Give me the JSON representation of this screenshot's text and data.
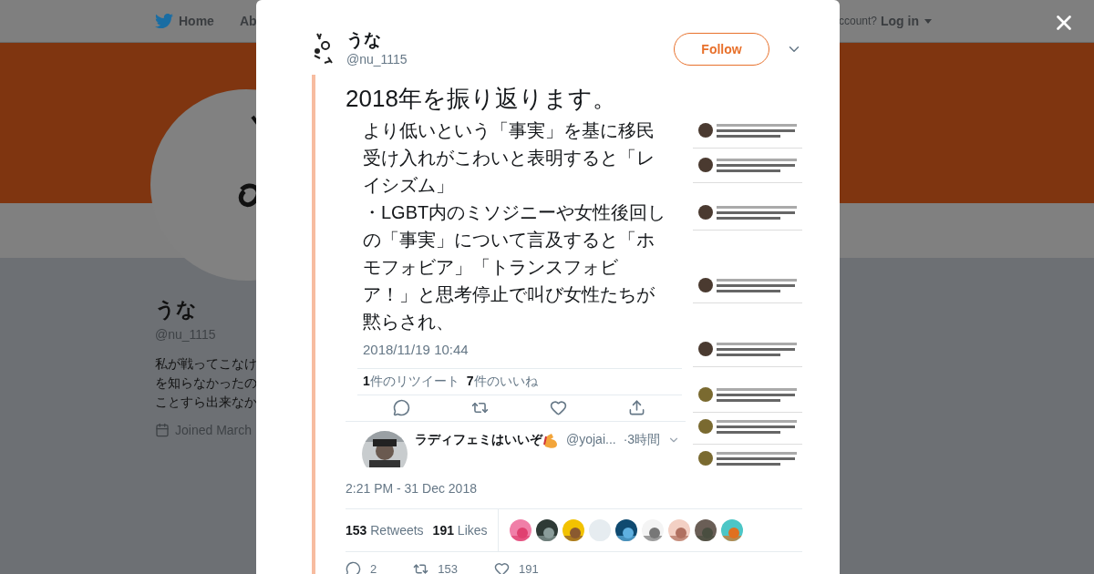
{
  "background_page": {
    "nav": [
      {
        "label": "Home",
        "kind": "home"
      },
      {
        "label": "Ab",
        "kind": "plain"
      }
    ],
    "login_prompt": "ccount?",
    "login_link": "Log in",
    "profile": {
      "name": "うな",
      "handle": "@nu_1115",
      "bio_lines": [
        "私が戦ってこなけ",
        "を知らなかったの",
        "ことすら出来なか"
      ],
      "joined": "Joined March"
    }
  },
  "modal": {
    "author": {
      "name": "うな",
      "handle": "@nu_1115"
    },
    "follow_button": "Follow",
    "tweet_text": "2018年を振り返ります。",
    "attachment": {
      "lines": [
        "より低いという「事実」を基に移民",
        "受け入れがこわいと表明すると「レ",
        "イシズム」",
        "・LGBT内のミソジニーや女性後回し",
        "の「事実」について言及すると「ホ",
        "モフォビア」「トランスフォビ",
        "ア！」と思考停止で叫び女性たちが",
        "黙らされ、"
      ],
      "time": "2018/11/19 10:44",
      "stats": [
        {
          "count": "1",
          "label": "件のリツイート"
        },
        {
          "count": "7",
          "label": "件のいいね"
        }
      ],
      "reply": {
        "name": "ラディフェミはいいぞ",
        "handle": "@yojai...",
        "age": "·3時間"
      },
      "thumbnail": {
        "kind": "picture"
      }
    },
    "timestamp": "2:21 PM - 31 Dec 2018",
    "stats": [
      {
        "count": "153",
        "label": "Retweets"
      },
      {
        "count": "191",
        "label": "Likes"
      }
    ],
    "likers": [
      {
        "kind": "picture"
      },
      {
        "kind": "picture"
      },
      {
        "kind": "picture"
      },
      {
        "kind": "picture"
      },
      {
        "kind": "picture"
      },
      {
        "kind": "picture"
      },
      {
        "kind": "picture"
      },
      {
        "kind": "picture"
      },
      {
        "kind": "picture"
      }
    ],
    "actions": [
      {
        "kind": "reply",
        "count": "2"
      },
      {
        "kind": "retweet",
        "count": "153"
      },
      {
        "kind": "like",
        "count": "191"
      }
    ]
  }
}
